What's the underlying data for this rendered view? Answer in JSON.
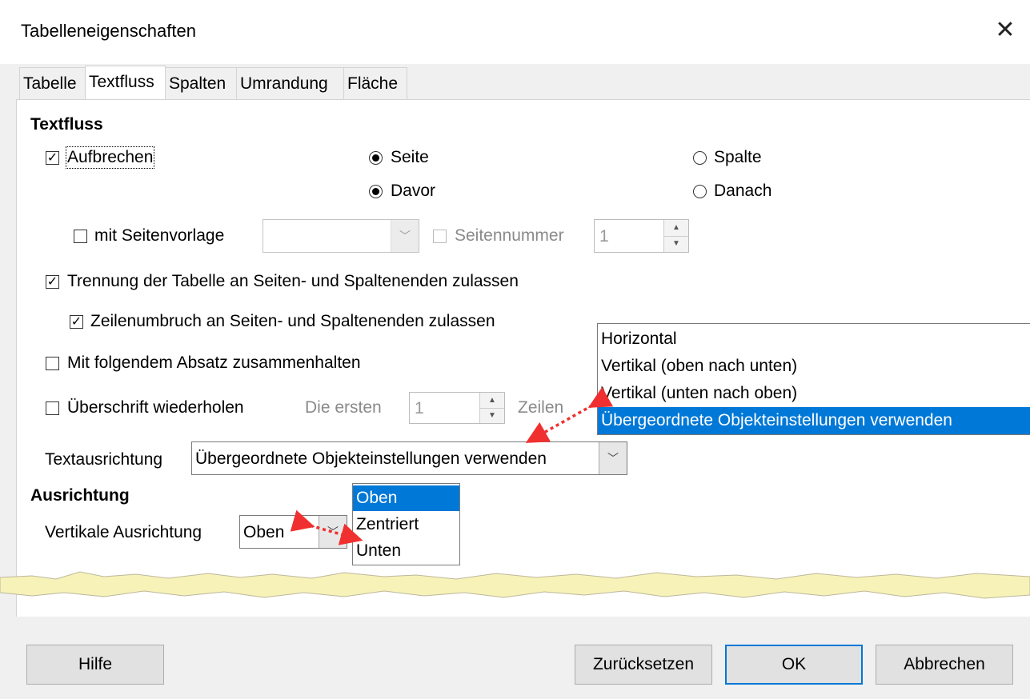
{
  "dialog": {
    "title": "Tabelleneigenschaften"
  },
  "tabs": [
    {
      "label": "Tabelle",
      "active": false
    },
    {
      "label": "Textfluss",
      "active": true
    },
    {
      "label": "Spalten",
      "active": false
    },
    {
      "label": "Umrandung",
      "active": false
    },
    {
      "label": "Fläche",
      "active": false
    }
  ],
  "textfluss": {
    "heading": "Textfluss",
    "aufbrechen": {
      "label": "Aufbrechen",
      "checked": true
    },
    "seite": {
      "label": "Seite",
      "selected": true
    },
    "spalte": {
      "label": "Spalte",
      "selected": false
    },
    "davor": {
      "label": "Davor",
      "selected": true
    },
    "danach": {
      "label": "Danach",
      "selected": false
    },
    "mit_seitenvorlage": {
      "label": "mit Seitenvorlage",
      "checked": false,
      "combo_value": ""
    },
    "seitennummer": {
      "label": "Seitennummer",
      "checked": false,
      "value": "1"
    },
    "trennung": {
      "label": "Trennung der Tabelle an Seiten- und Spaltenenden zulassen",
      "checked": true
    },
    "zeilenumbruch": {
      "label": "Zeilenumbruch an Seiten- und Spaltenenden zulassen",
      "checked": true
    },
    "zusammenhalten": {
      "label": "Mit folgendem Absatz zusammenhalten",
      "checked": false
    },
    "ueberschrift": {
      "label": "Überschrift wiederholen",
      "checked": false,
      "die_ersten": "Die ersten",
      "value": "1",
      "zeilen": "Zeilen"
    },
    "textausrichtung": {
      "label": "Textausrichtung",
      "value": "Übergeordnete Objekteinstellungen verwenden",
      "options": [
        "Horizontal",
        "Vertikal (oben nach unten)",
        "Vertikal (unten nach oben)",
        "Übergeordnete Objekteinstellungen verwenden"
      ],
      "selected_index": 3
    }
  },
  "ausrichtung": {
    "heading": "Ausrichtung",
    "vertikal": {
      "label": "Vertikale Ausrichtung",
      "value": "Oben",
      "options": [
        "Oben",
        "Zentriert",
        "Unten"
      ],
      "selected_index": 0
    }
  },
  "buttons": {
    "help": "Hilfe",
    "reset": "Zurücksetzen",
    "ok": "OK",
    "cancel": "Abbrechen"
  },
  "colors": {
    "selection": "#0078d7",
    "arrow": "#f03030",
    "tear": "#f7f2b8"
  }
}
